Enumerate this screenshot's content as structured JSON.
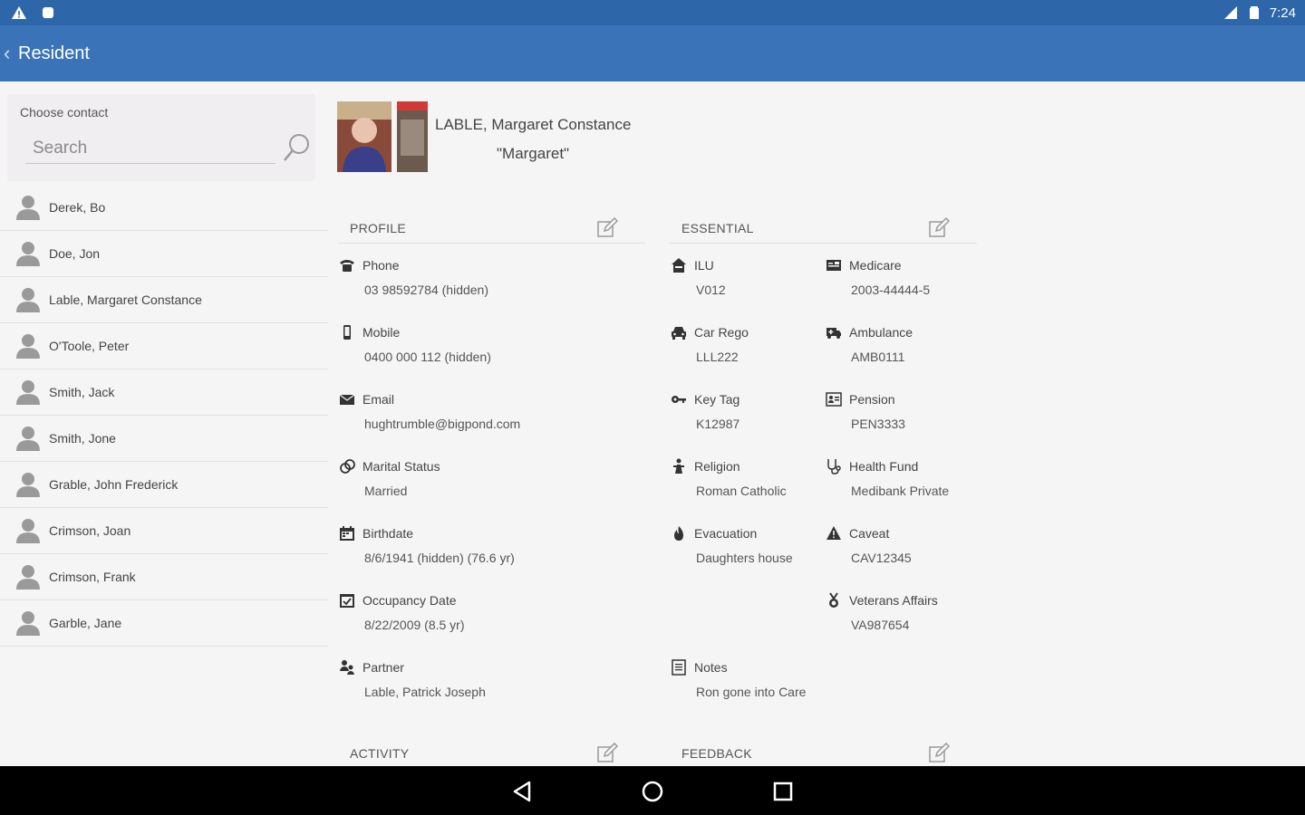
{
  "status_bar": {
    "time": "7:24",
    "left_icons": [
      "warning-icon",
      "notification-icon"
    ],
    "right_icons": [
      "signal-icon",
      "battery-icon"
    ]
  },
  "app_bar": {
    "title": "Resident"
  },
  "sidebar": {
    "choose_label": "Choose contact",
    "search_placeholder": "Search",
    "contacts": [
      {
        "name": "Derek, Bo"
      },
      {
        "name": "Doe, Jon"
      },
      {
        "name": "Lable, Margaret Constance"
      },
      {
        "name": "O'Toole, Peter"
      },
      {
        "name": "Smith, Jack"
      },
      {
        "name": "Smith, Jone"
      },
      {
        "name": "Grable, John Frederick"
      },
      {
        "name": "Crimson, Joan"
      },
      {
        "name": "Crimson, Frank"
      },
      {
        "name": "Garble, Jane"
      }
    ]
  },
  "resident": {
    "full_name": "LABLE, Margaret Constance",
    "nickname": "\"Margaret\""
  },
  "sections": {
    "profile": "PROFILE",
    "essential": "ESSENTIAL",
    "activity": "ACTIVITY",
    "feedback": "FEEDBACK"
  },
  "profile": {
    "phone": {
      "label": "Phone",
      "value": "03 98592784 (hidden)",
      "icon": "phone-icon"
    },
    "mobile": {
      "label": "Mobile",
      "value": "0400 000 112 (hidden)",
      "icon": "mobile-icon"
    },
    "email": {
      "label": "Email",
      "value": "hughtrumble@bigpond.com",
      "icon": "email-icon"
    },
    "marital": {
      "label": "Marital Status",
      "value": "Married",
      "icon": "rings-icon"
    },
    "birthdate": {
      "label": "Birthdate",
      "value": "8/6/1941 (hidden) (76.6 yr)",
      "icon": "calendar-icon"
    },
    "occupancy": {
      "label": "Occupancy Date",
      "value": "8/22/2009 (8.5 yr)",
      "icon": "calendar-check-icon"
    },
    "partner": {
      "label": "Partner",
      "value": "Lable, Patrick Joseph",
      "icon": "partner-icon"
    }
  },
  "essential": {
    "ilu": {
      "label": "ILU",
      "value": "V012",
      "icon": "home-icon"
    },
    "medicare": {
      "label": "Medicare",
      "value": "2003-44444-5",
      "icon": "card-icon"
    },
    "car_rego": {
      "label": "Car Rego",
      "value": "LLL222",
      "icon": "car-icon"
    },
    "ambulance": {
      "label": "Ambulance",
      "value": "AMB0111",
      "icon": "ambulance-icon"
    },
    "key_tag": {
      "label": "Key Tag",
      "value": "K12987",
      "icon": "key-icon"
    },
    "pension": {
      "label": "Pension",
      "value": "PEN3333",
      "icon": "id-card-icon"
    },
    "religion": {
      "label": "Religion",
      "value": "Roman Catholic",
      "icon": "religion-icon"
    },
    "health_fund": {
      "label": "Health Fund",
      "value": "Medibank Private",
      "icon": "stethoscope-icon"
    },
    "evacuation": {
      "label": "Evacuation",
      "value": "Daughters house",
      "icon": "fire-icon"
    },
    "caveat": {
      "label": "Caveat",
      "value": "CAV12345",
      "icon": "warning-triangle-icon"
    },
    "veterans": {
      "label": "Veterans Affairs",
      "value": "VA987654",
      "icon": "medal-icon"
    },
    "notes": {
      "label": "Notes",
      "value": "Ron gone into Care",
      "icon": "notes-icon"
    }
  },
  "colors": {
    "status_bar": "#2e67a9",
    "app_bar": "#3b73b9",
    "background": "#f5f5f5",
    "nav_bar": "#000000"
  }
}
